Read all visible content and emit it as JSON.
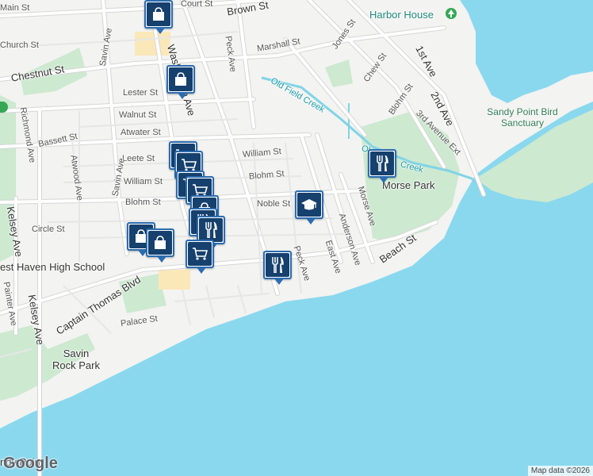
{
  "colors": {
    "water": "#8ad8ee",
    "land": "#f3f3f1",
    "park": "#cde9d0",
    "road": "#ffffff",
    "road_stroke": "#d6d6d6",
    "creek": "#7fd4e6",
    "pin_border": "#2b6cb0",
    "pin_fill": "#16406d",
    "highlight": "#fbe8b8"
  },
  "streets": {
    "main_st": "Main St",
    "church_st": "Church St",
    "chestnut_st": "Chestnut St",
    "court_st": "Court St",
    "brown_st": "Brown St",
    "washington_ave": "Washington Ave",
    "peck_ave_top": "Peck Ave",
    "marshall_st": "Marshall St",
    "jones_st": "Jones St",
    "chew_st": "Chew St",
    "first_ave": "1st Ave",
    "second_ave": "2nd Ave",
    "third_ave_ext": "3rd Avenue Ext",
    "blohm_st_ne": "Blohm St",
    "lester_st": "Lester St",
    "walnut_st": "Walnut St",
    "savin_ave_top": "Savin Ave",
    "atwater_st": "Atwater St",
    "bassett_st": "Bassett St",
    "richmond_ave": "Richmond Ave",
    "atwood_ave": "Atwood Ave",
    "leete_st": "Leete St",
    "william_st_w": "William St",
    "william_st_e": "William St",
    "blohm_st_w": "Blohm St",
    "blohm_st_e": "Blohm St",
    "noble_st": "Noble St",
    "circle_st": "Circle St",
    "kelsey_ave_left": "Kelsey Ave",
    "kelsey_ave_bottom": "Kelsey Ave",
    "painter_ave": "Painter Ave",
    "savin_ave_mid": "Savin Ave",
    "peck_ave_bottom": "Peck Ave",
    "east_ave": "East Ave",
    "anderson_ave": "Anderson Ave",
    "morse_ave": "Morse Ave",
    "beach_st": "Beach St",
    "captain_thomas_blvd": "Captain Thomas Blvd",
    "palace_st": "Palace St"
  },
  "places": {
    "harbor_house": "Harbor House",
    "west_haven_hs": "est Haven High School",
    "savin_rock_park": "Savin Rock Park",
    "morse_park": "Morse Park",
    "sandy_point": "Sandy Point Bird Sanctuary",
    "old_field_creek_1": "Old Field Creek",
    "old_field_creek_2": "Creek",
    "old_field_creek_2a": "Ol",
    "sandy_point_bottom": "ndy Point"
  },
  "icons": {
    "shopping_bag": "shopping-bag-icon",
    "shopping_cart": "shopping-cart-icon",
    "restaurant": "restaurant-icon",
    "school": "school-icon",
    "park_tree": "park-tree-icon"
  },
  "footer": {
    "logo": "Google",
    "attribution": "Map data ©2026"
  }
}
